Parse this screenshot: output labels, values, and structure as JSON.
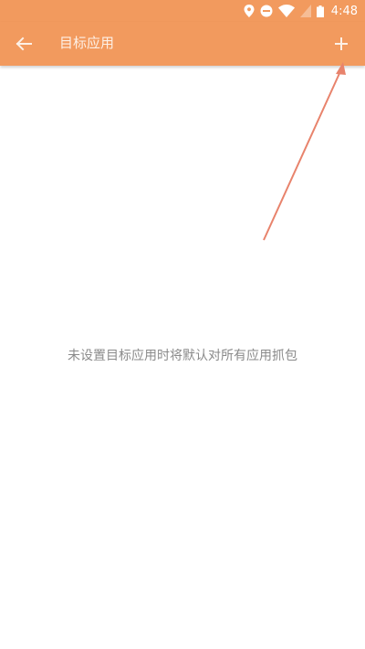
{
  "status_bar": {
    "time": "4:48",
    "icons": [
      "location-icon",
      "do-not-disturb-icon",
      "wifi-icon",
      "signal-icon",
      "battery-icon"
    ]
  },
  "toolbar": {
    "title": "目标应用",
    "back_icon": "arrow-left-icon",
    "add_icon": "plus-icon"
  },
  "main": {
    "empty_message": "未设置目标应用时将默认对所有应用抓包"
  },
  "colors": {
    "primary": "#f29a5e",
    "annotation_arrow": "#e8836c"
  }
}
